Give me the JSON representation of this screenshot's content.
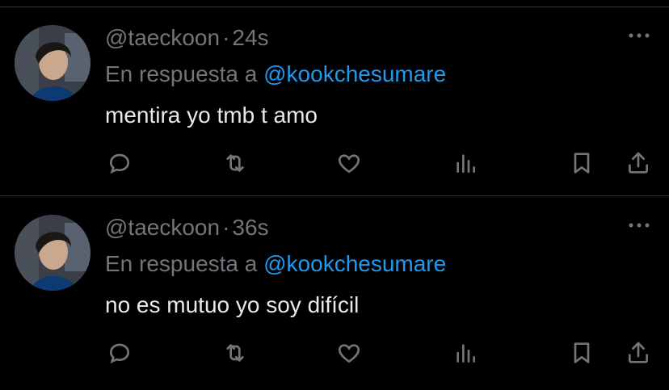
{
  "tweets": [
    {
      "handle": "@taeckoon",
      "separator": "·",
      "time": "24s",
      "reply_prefix": "En respuesta a",
      "reply_to": "@kookchesumare",
      "text": "mentira yo tmb t amo"
    },
    {
      "handle": "@taeckoon",
      "separator": "·",
      "time": "36s",
      "reply_prefix": "En respuesta a",
      "reply_to": "@kookchesumare",
      "text": "no es mutuo yo soy difícil"
    }
  ],
  "icons": [
    "reply-icon",
    "retweet-icon",
    "like-icon",
    "views-icon",
    "bookmark-icon",
    "share-icon",
    "more-icon"
  ],
  "colors": {
    "background": "#000000",
    "text": "#e7e9ea",
    "muted": "#71767b",
    "link": "#1d9bf0",
    "divider": "#2f3336"
  }
}
